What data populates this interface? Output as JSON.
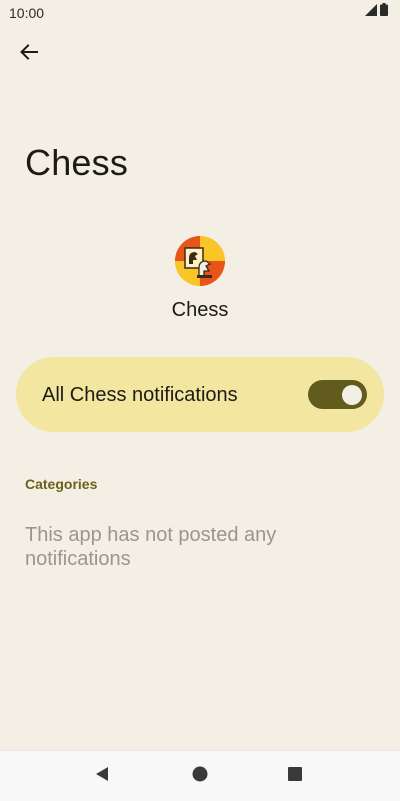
{
  "status_bar": {
    "time": "10:00",
    "icons": [
      "signal-icon",
      "battery-icon"
    ]
  },
  "toolbar": {
    "back_icon": "arrow-left-icon"
  },
  "page": {
    "title": "Chess"
  },
  "app": {
    "name": "Chess",
    "icon": "chess-app-icon"
  },
  "main_toggle": {
    "label": "All Chess notifications",
    "enabled": true,
    "accent_color": "#615b1e",
    "card_color": "#f2e6a0"
  },
  "categories": {
    "header": "Categories",
    "empty_message": "This app has not posted any notifications"
  },
  "nav_bar": {
    "buttons": [
      "back-triangle-icon",
      "home-circle-icon",
      "recents-square-icon"
    ]
  },
  "theme": {
    "background": "#f4efe4",
    "section_header_color": "#6a621c",
    "secondary_text_color": "#9a968c"
  }
}
